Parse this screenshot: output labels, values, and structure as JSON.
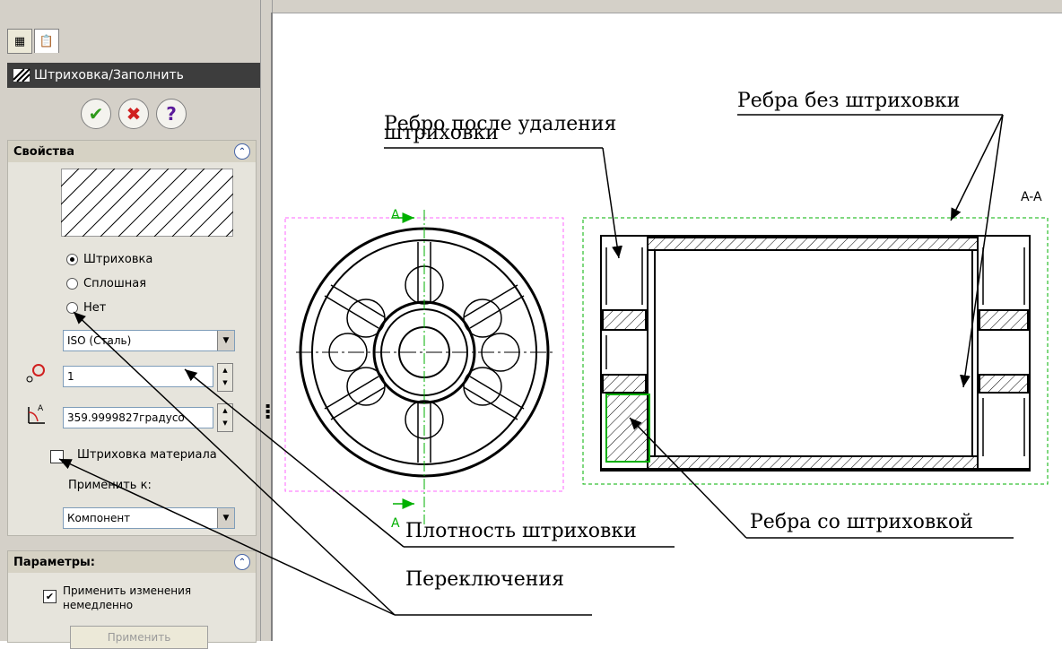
{
  "panel": {
    "title": "Штриховка/Заполнить",
    "buttons": {
      "ok": "✔",
      "cancel": "✖",
      "help": "?"
    },
    "properties": {
      "header": "Свойства",
      "radios": [
        {
          "label": "Штриховка",
          "checked": true
        },
        {
          "label": "Сплошная",
          "checked": false
        },
        {
          "label": "Нет",
          "checked": false
        }
      ],
      "pattern_value": "ISO (Сталь)",
      "scale_value": "1",
      "angle_value": "359.9999827градусо",
      "material_hatch_label": "Штриховка материала",
      "material_hatch_checked": false,
      "apply_to_label": "Применить к:",
      "apply_to_value": "Компонент"
    },
    "parameters": {
      "header": "Параметры:",
      "apply_immediately_label_1": "Применить изменения",
      "apply_immediately_label_2": "немедленно",
      "apply_immediately_checked": true,
      "apply_button": "Применить"
    }
  },
  "drawing": {
    "section_mark_top": "A",
    "section_mark_bottom": "A",
    "section_label": "A-A"
  },
  "annotations": {
    "rib_after_removal_1": "Ребро после удаления",
    "rib_after_removal_2": "штриховки",
    "ribs_no_hatch": "Ребра без штриховки",
    "hatch_density": "Плотность штриховки",
    "ribs_with_hatch": "Ребра со штриховкой",
    "switches": "Переключения"
  },
  "colors": {
    "section_green": "#00b000",
    "view_magenta": "#ff66ff",
    "panel_bg": "#d4d0c8"
  }
}
